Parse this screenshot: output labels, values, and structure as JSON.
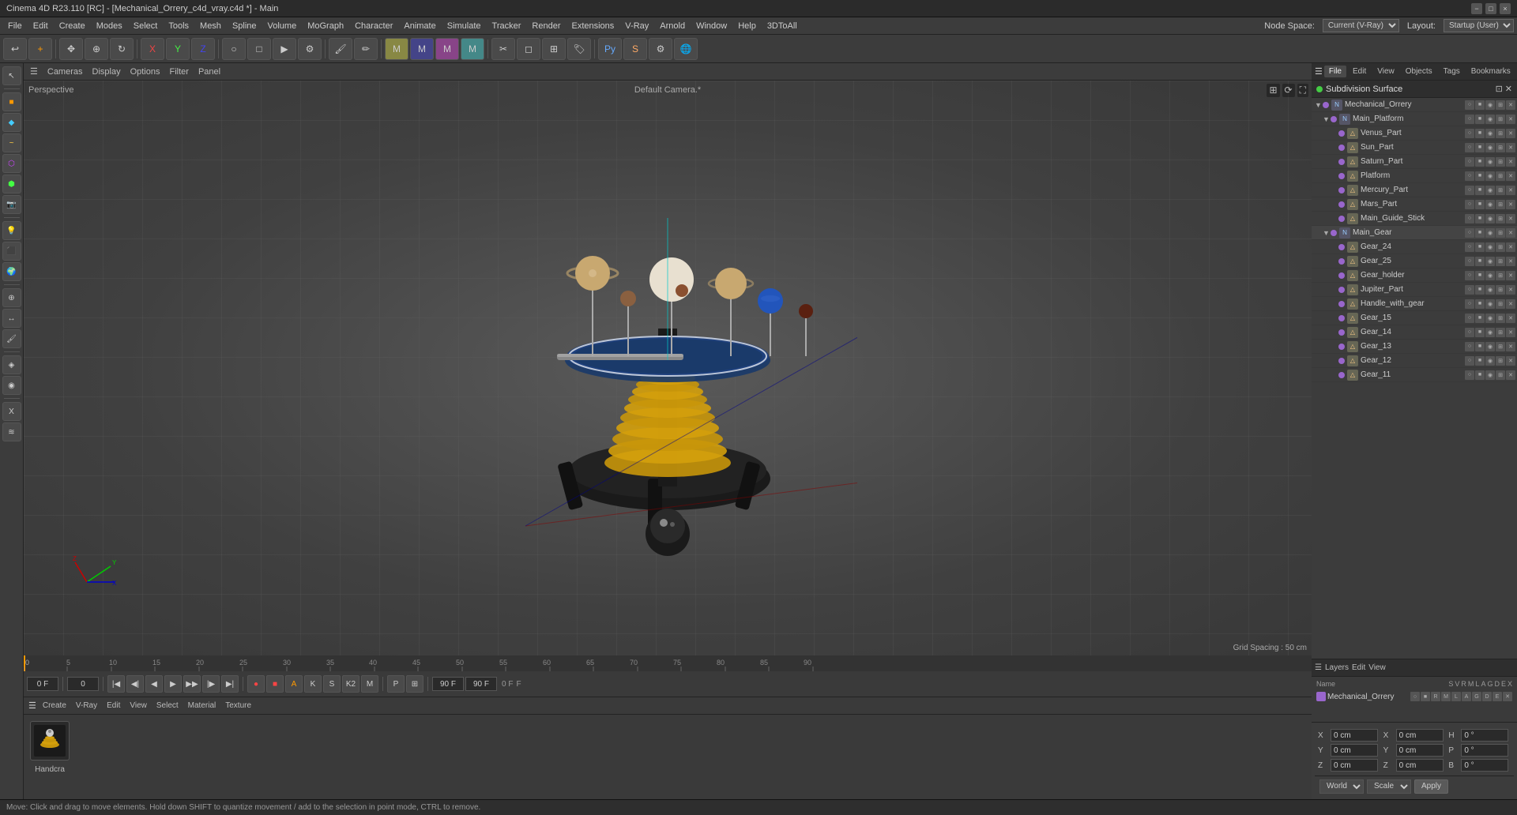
{
  "window": {
    "title": "Cinema 4D R23.110 [RC] - [Mechanical_Orrery_c4d_vray.c4d *] - Main",
    "controls": [
      "−",
      "□",
      "×"
    ]
  },
  "menubar": {
    "items": [
      "File",
      "Edit",
      "Create",
      "Modes",
      "Select",
      "Tools",
      "Mesh",
      "Spline",
      "Volume",
      "MoGraph",
      "Character",
      "Animate",
      "Simulate",
      "Tracker",
      "Render",
      "Extensions",
      "V-Ray",
      "Arnold",
      "Window",
      "Help",
      "3DToAll"
    ],
    "node_space_label": "Node Space:",
    "node_space_value": "Current (V-Ray)",
    "layout_label": "Layout:",
    "layout_value": "Startup (User)"
  },
  "viewport": {
    "label": "Perspective",
    "camera": "Default Camera.*",
    "grid_spacing": "Grid Spacing : 50 cm"
  },
  "timeline": {
    "start_frame": "0",
    "end_frame": "90 F",
    "current_frame": "0 F",
    "current_frame2": "0",
    "playback_end": "90 F",
    "ticks": [
      "0",
      "5",
      "10",
      "15",
      "20",
      "25",
      "30",
      "35",
      "40",
      "45",
      "50",
      "55",
      "60",
      "65",
      "70",
      "75",
      "80",
      "85",
      "90"
    ]
  },
  "scene_manager": {
    "tabs": [
      "File",
      "Edit",
      "View",
      "Objects",
      "Tags",
      "Bookmarks"
    ],
    "subdiv_surface": "Subdivision Surface",
    "objects": [
      {
        "name": "Mechanical_Orrery",
        "level": 0,
        "arrow": "▼",
        "color": "#9966cc"
      },
      {
        "name": "Main_Platform",
        "level": 1,
        "arrow": "▼",
        "color": "#9966cc"
      },
      {
        "name": "Venus_Part",
        "level": 2,
        "arrow": "",
        "color": "#9966cc"
      },
      {
        "name": "Sun_Part",
        "level": 2,
        "arrow": "",
        "color": "#9966cc"
      },
      {
        "name": "Saturn_Part",
        "level": 2,
        "arrow": "",
        "color": "#9966cc"
      },
      {
        "name": "Platform",
        "level": 2,
        "arrow": "",
        "color": "#9966cc"
      },
      {
        "name": "Mercury_Part",
        "level": 2,
        "arrow": "",
        "color": "#9966cc"
      },
      {
        "name": "Mars_Part",
        "level": 2,
        "arrow": "",
        "color": "#9966cc"
      },
      {
        "name": "Main_Guide_Stick",
        "level": 2,
        "arrow": "",
        "color": "#9966cc"
      },
      {
        "name": "Main_Gear",
        "level": 1,
        "arrow": "▼",
        "color": "#9966cc"
      },
      {
        "name": "Gear_24",
        "level": 2,
        "arrow": "",
        "color": "#9966cc"
      },
      {
        "name": "Gear_25",
        "level": 2,
        "arrow": "",
        "color": "#9966cc"
      },
      {
        "name": "Gear_holder",
        "level": 2,
        "arrow": "",
        "color": "#9966cc"
      },
      {
        "name": "Jupiter_Part",
        "level": 2,
        "arrow": "",
        "color": "#9966cc"
      },
      {
        "name": "Handle_with_gear",
        "level": 2,
        "arrow": "",
        "color": "#9966cc"
      },
      {
        "name": "Gear_15",
        "level": 2,
        "arrow": "",
        "color": "#9966cc"
      },
      {
        "name": "Gear_14",
        "level": 2,
        "arrow": "",
        "color": "#9966cc"
      },
      {
        "name": "Gear_13",
        "level": 2,
        "arrow": "",
        "color": "#9966cc"
      },
      {
        "name": "Gear_12",
        "level": 2,
        "arrow": "",
        "color": "#9966cc"
      },
      {
        "name": "Gear_11",
        "level": 2,
        "arrow": "",
        "color": "#9966cc"
      }
    ]
  },
  "layers": {
    "tabs": [
      "Layers",
      "Edit",
      "View"
    ],
    "columns": [
      "Name",
      "S",
      "V",
      "R",
      "M",
      "L",
      "A",
      "G",
      "D",
      "E",
      "X"
    ],
    "items": [
      {
        "name": "Mechanical_Orrery",
        "color": "#9966cc"
      }
    ]
  },
  "coordinates": {
    "position": {
      "x": "0 cm",
      "y": "0 cm",
      "z": "0 cm"
    },
    "size": {
      "x": "0 cm",
      "y": "0 cm",
      "z": "0 cm"
    },
    "rotation": {
      "p": "0 °",
      "b": "0 °",
      "h": "0 °"
    },
    "world_label": "World",
    "scale_label": "Scale",
    "apply_label": "Apply"
  },
  "anim_toolbar": {
    "tabs": [
      "Create",
      "V-Ray",
      "Edit",
      "View",
      "Select",
      "Material",
      "Texture"
    ]
  },
  "statusbar": {
    "message": "Move: Click and drag to move elements. Hold down SHIFT to quantize movement / add to the selection in point mode, CTRL to remove."
  },
  "object_thumbnail": {
    "label": "Handcra"
  }
}
